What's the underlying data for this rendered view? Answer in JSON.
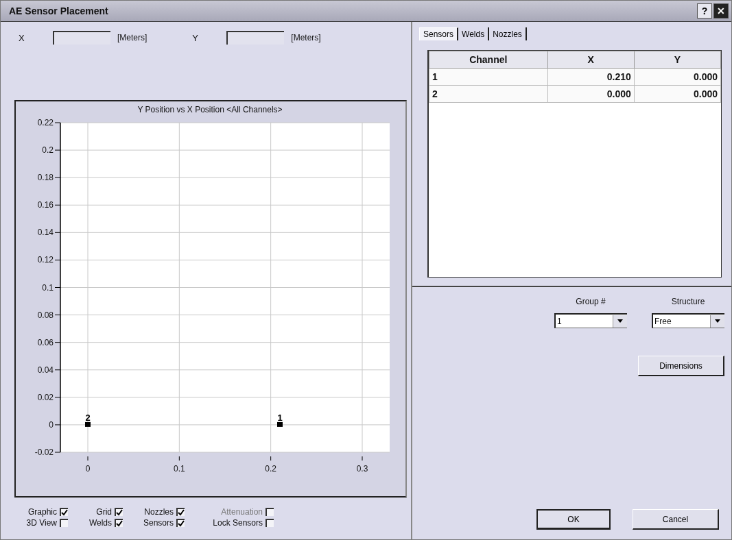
{
  "window": {
    "title": "AE Sensor Placement",
    "help_button": "?",
    "close_button": "✕"
  },
  "position_fields": [
    {
      "label": "X",
      "unit": "[Meters]"
    },
    {
      "label": "Y",
      "unit": "[Meters]"
    }
  ],
  "chart": {
    "chart_data": {
      "type": "scatter",
      "grid": true,
      "title": "Y Position vs X Position <All Channels>",
      "xlim": [
        -0.03,
        0.33
      ],
      "ylim": [
        -0.02,
        0.22
      ],
      "xticks": [
        0,
        0.1,
        0.2,
        0.3
      ],
      "yticks": [
        -0.02,
        0,
        0.02,
        0.04,
        0.06,
        0.08,
        0.1,
        0.12,
        0.14,
        0.16,
        0.18,
        0.2,
        0.22
      ],
      "x": [
        0.21,
        0
      ],
      "series": [
        {
          "color": "#000000",
          "values": [
            0,
            0
          ]
        }
      ],
      "annotations": [
        {
          "x": 0.21,
          "y": 0,
          "text": "1"
        },
        {
          "x": 0,
          "y": 0,
          "text": "2"
        }
      ]
    }
  },
  "options": [
    {
      "label": "Graphic",
      "checked": true,
      "disabled": false
    },
    {
      "label": "Grid",
      "checked": true,
      "disabled": false
    },
    {
      "label": "Nozzles",
      "checked": true,
      "disabled": false
    },
    {
      "label": "Attenuation",
      "checked": false,
      "disabled": true
    },
    {
      "label": "3D View",
      "checked": false,
      "disabled": false
    },
    {
      "label": "Welds",
      "checked": true,
      "disabled": false
    },
    {
      "label": "Sensors",
      "checked": true,
      "disabled": false
    },
    {
      "label": "Lock Sensors",
      "checked": false,
      "disabled": false
    }
  ],
  "tabs": [
    {
      "label": "Sensors",
      "selected": true
    },
    {
      "label": "Welds",
      "selected": false
    },
    {
      "label": "Nozzles",
      "selected": false
    }
  ],
  "table": {
    "columns": [
      "Channel",
      "X",
      "Y"
    ],
    "rows": [
      [
        "1",
        "0.210",
        "0.000"
      ],
      [
        "2",
        "0.000",
        "0.000"
      ]
    ]
  },
  "group": {
    "label": "Group #",
    "value": "1"
  },
  "structure": {
    "label": "Structure",
    "value": "Free"
  },
  "buttons": {
    "dimensions": "Dimensions",
    "ok": "OK",
    "cancel": "Cancel"
  }
}
